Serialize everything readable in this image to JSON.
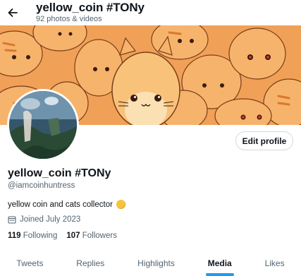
{
  "header": {
    "title": "yellow_coin #TONy",
    "subtitle": "92 photos & videos"
  },
  "banner": {
    "description_icon": "cartoon-cats-banner"
  },
  "profile": {
    "edit_label": "Edit profile",
    "name": "yellow_coin #TONy",
    "handle": "@iamcoinhuntress",
    "bio": "yellow coin and cats collector",
    "joined": "Joined July 2023",
    "following_count": "119",
    "following_label": "Following",
    "followers_count": "107",
    "followers_label": "Followers"
  },
  "tabs": [
    {
      "label": "Tweets",
      "active": false
    },
    {
      "label": "Replies",
      "active": false
    },
    {
      "label": "Highlights",
      "active": false
    },
    {
      "label": "Media",
      "active": true
    },
    {
      "label": "Likes",
      "active": false
    }
  ],
  "colors": {
    "accent": "#1d9bf0",
    "coin": "#f7c33b",
    "banner": "#f3a55b"
  }
}
